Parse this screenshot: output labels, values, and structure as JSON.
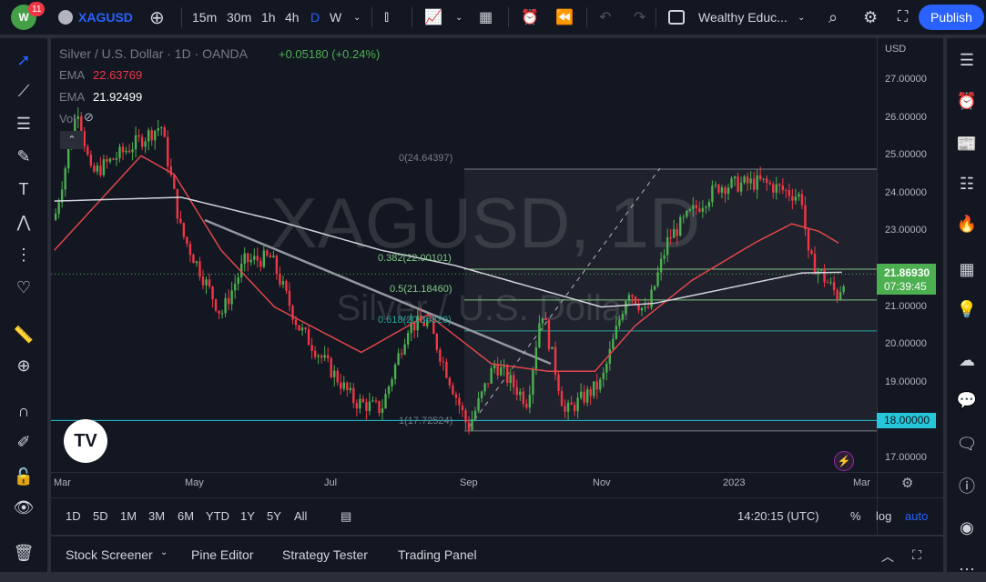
{
  "toolbar": {
    "badge": "11",
    "symbol": "XAGUSD",
    "intervals": [
      "15m",
      "30m",
      "1h",
      "4h",
      "D",
      "W"
    ],
    "active_interval": "D",
    "layout_name": "Wealthy Educ...",
    "publish": "Publish"
  },
  "legend": {
    "title": "Silver / U.S. Dollar · 1D · OANDA",
    "change": "+0.05180 (+0.24%)",
    "ema1_label": "EMA",
    "ema1_value": "22.63769",
    "ema2_label": "EMA",
    "ema2_value": "21.92499",
    "vol_label": "Vol"
  },
  "watermark": {
    "symbol": "XAGUSD, 1D",
    "name": "Silver / U.S. Dollar"
  },
  "fib": {
    "l0": "0(24.64397)",
    "l382": "0.382(22.00101)",
    "l5": "0.5(21.18460)",
    "l618": "0.618(20.36820)",
    "l1": "1(17.72524)"
  },
  "price_axis": {
    "currency": "USD",
    "ticks": [
      "27.00000",
      "26.00000",
      "25.00000",
      "24.00000",
      "23.00000",
      "22.00000",
      "21.00000",
      "20.00000",
      "19.00000",
      "18.00000",
      "17.00000"
    ],
    "last_price": "21.86930",
    "countdown": "07:39:45",
    "level_label": "18.00000"
  },
  "time_axis": {
    "labels": [
      "Mar",
      "May",
      "Jul",
      "Sep",
      "Nov",
      "2023",
      "Mar"
    ]
  },
  "ranges": {
    "items": [
      "1D",
      "5D",
      "1M",
      "3M",
      "6M",
      "YTD",
      "1Y",
      "5Y",
      "All"
    ],
    "clock": "14:20:15 (UTC)",
    "percent": "%",
    "log": "log",
    "auto": "auto"
  },
  "bottom_panel": {
    "tabs": [
      "Stock Screener",
      "Pine Editor",
      "Strategy Tester",
      "Trading Panel"
    ]
  },
  "colors": {
    "up": "#4caf50",
    "down": "#f23645",
    "ema_fast": "#e0464a",
    "ema_slow": "#d1d4dc",
    "accent": "#2962ff",
    "fib_green": "#81c784",
    "fib_teal": "#26a69a"
  },
  "chart_data": {
    "type": "candlestick",
    "x_unit": "months since Mar 2022",
    "price_path": [
      [
        -0.1,
        23.3
      ],
      [
        0.25,
        26.3
      ],
      [
        0.45,
        24.5
      ],
      [
        1.5,
        25.8
      ],
      [
        1.8,
        23.0
      ],
      [
        2.4,
        20.8
      ],
      [
        2.75,
        22.2
      ],
      [
        3.15,
        22.3
      ],
      [
        3.55,
        20.5
      ],
      [
        4.4,
        18.5
      ],
      [
        4.8,
        18.3
      ],
      [
        5.2,
        20.5
      ],
      [
        5.5,
        20.6
      ],
      [
        6.1,
        17.8
      ],
      [
        6.5,
        19.5
      ],
      [
        6.99,
        18.5
      ],
      [
        7.2,
        21.0
      ],
      [
        7.55,
        18.2
      ],
      [
        8.1,
        19.0
      ],
      [
        8.5,
        21.5
      ],
      [
        8.77,
        20.8
      ],
      [
        9.1,
        22.8
      ],
      [
        9.45,
        23.5
      ],
      [
        9.86,
        24.2
      ],
      [
        10.5,
        24.3
      ],
      [
        11.1,
        23.9
      ],
      [
        11.2,
        22.3
      ],
      [
        11.64,
        21.3
      ],
      [
        11.75,
        21.87
      ]
    ],
    "ema_fast": [
      [
        -0.1,
        22.5
      ],
      [
        1.2,
        25.0
      ],
      [
        1.7,
        24.5
      ],
      [
        2.4,
        22.5
      ],
      [
        3.2,
        21.0
      ],
      [
        4.5,
        19.8
      ],
      [
        5.5,
        20.8
      ],
      [
        6.45,
        19.5
      ],
      [
        7.3,
        19.3
      ],
      [
        8.0,
        19.3
      ],
      [
        8.6,
        20.5
      ],
      [
        9.45,
        21.7
      ],
      [
        10.4,
        22.7
      ],
      [
        10.95,
        23.2
      ],
      [
        11.36,
        23.0
      ],
      [
        11.7,
        22.64
      ]
    ],
    "ema_slow": [
      [
        -0.1,
        23.8
      ],
      [
        1.8,
        23.9
      ],
      [
        3.2,
        23.3
      ],
      [
        4.8,
        22.5
      ],
      [
        5.9,
        22.1
      ],
      [
        7.3,
        21.4
      ],
      [
        8.1,
        21.0
      ],
      [
        8.9,
        21.1
      ],
      [
        10.0,
        21.5
      ],
      [
        11.1,
        21.9
      ],
      [
        11.75,
        21.92
      ]
    ],
    "y_range": [
      16.6,
      27.8
    ]
  }
}
